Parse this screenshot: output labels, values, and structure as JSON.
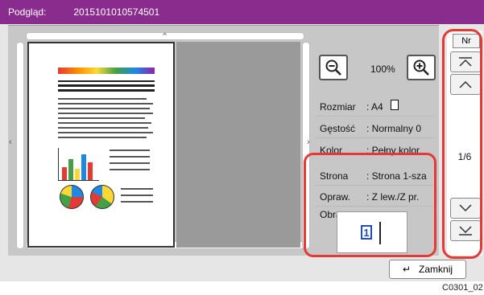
{
  "title": {
    "label": "Podgląd:",
    "doc_id": "2015101010574501"
  },
  "zoom": {
    "value": "100%"
  },
  "properties": [
    {
      "label": "Rozmiar",
      "value": ": A4"
    },
    {
      "label": "Gęstość",
      "value": ": Normalny 0"
    },
    {
      "label": "Kolor",
      "value": ": Pełny kolor"
    },
    {
      "label": "Strona",
      "value": ": Strona 1-sza"
    },
    {
      "label": "Opraw.",
      "value": ": Z lew./Z pr."
    },
    {
      "label": "Obraz",
      "value": "1"
    }
  ],
  "nav": {
    "header": "Nr",
    "page": "1/6"
  },
  "footer": {
    "close_label": "Zamknij",
    "image_code": "C0301_02"
  },
  "colors": {
    "accent": "#8a2c8d",
    "highlight": "#e53935"
  }
}
